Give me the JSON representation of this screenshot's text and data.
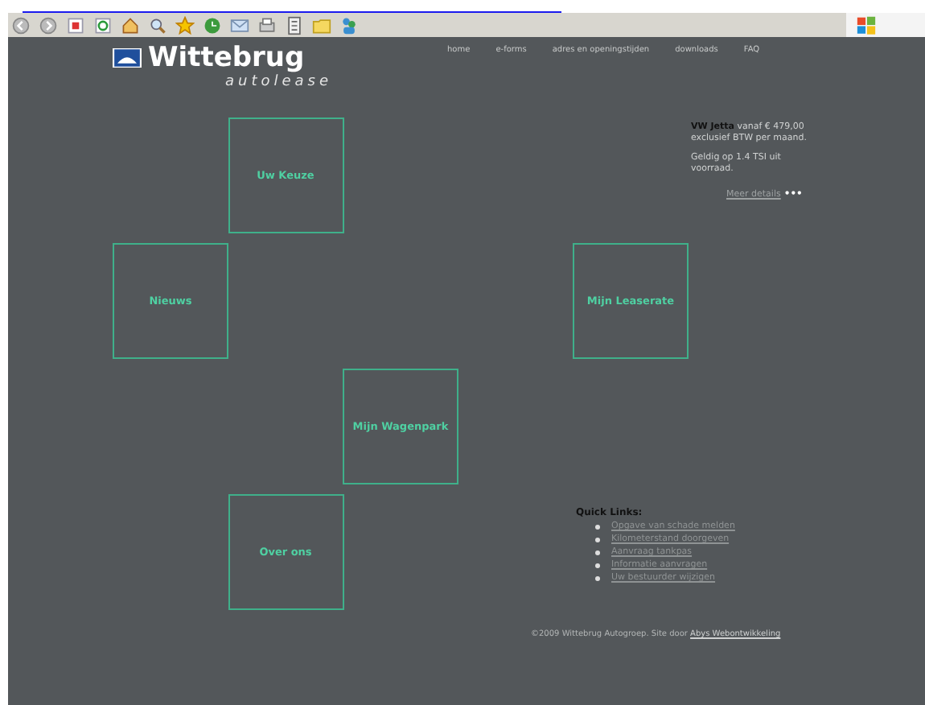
{
  "header": {
    "brand": "Wittebrug",
    "tagline": "autolease",
    "nav": [
      {
        "label": "home"
      },
      {
        "label": "e-forms"
      },
      {
        "label": "adres en openingstijden"
      },
      {
        "label": "downloads"
      },
      {
        "label": "FAQ"
      }
    ]
  },
  "tiles": [
    {
      "label": "Uw Keuze"
    },
    {
      "label": "Nieuws"
    },
    {
      "label": "Mijn Leaserate"
    },
    {
      "label": "Mijn Wagenpark"
    },
    {
      "label": "Over ons"
    }
  ],
  "promo": {
    "text": "**VW Jetta** vanaf € 479,00 exclusief BTW per maand.",
    "note": "Geldig op 1.4 TSI uit voorraad.",
    "link": "Meer details",
    "dots": "•••"
  },
  "quick_links": {
    "title": "Quick Links:",
    "items": [
      "Opgave van schade melden",
      "Kilometerstand doorgeven",
      "Aanvraag tankpas",
      "Informatie aanvragen",
      "Uw bestuurder wijzigen"
    ]
  },
  "footer": {
    "text": "©2009 Wittebrug Autogroep. Site door",
    "link": "Abys Webontwikkeling"
  }
}
